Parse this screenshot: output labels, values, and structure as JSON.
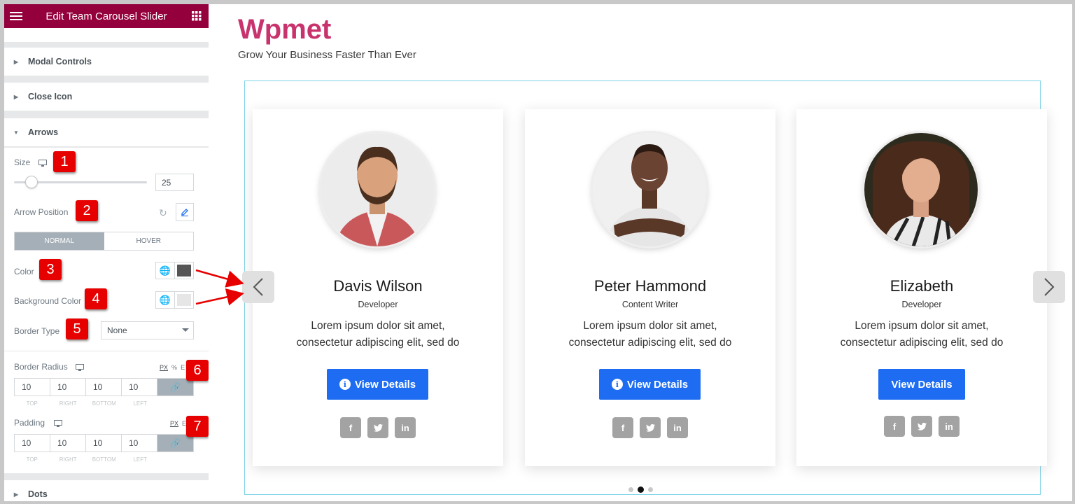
{
  "editor": {
    "title": "Edit Team Carousel Slider",
    "sections": {
      "modal_controls": "Modal Controls",
      "close_icon": "Close Icon",
      "arrows": "Arrows",
      "dots": "Dots"
    },
    "size": {
      "label": "Size",
      "value": "25",
      "slider_fraction": 0.12
    },
    "arrow_position": {
      "label": "Arrow Position"
    },
    "tabs": {
      "normal": "NORMAL",
      "hover": "HOVER"
    },
    "color": {
      "label": "Color",
      "swatch": "#555555"
    },
    "background_color": {
      "label": "Background Color",
      "swatch": "#e6e6e6"
    },
    "border_type": {
      "label": "Border Type",
      "value": "None"
    },
    "border_radius": {
      "label": "Border Radius",
      "units": {
        "px": "PX",
        "percent": "%",
        "em": "E"
      },
      "values": {
        "top": "10",
        "right": "10",
        "bottom": "10",
        "left": "10"
      },
      "labels": {
        "top": "TOP",
        "right": "RIGHT",
        "bottom": "BOTTOM",
        "left": "LEFT"
      }
    },
    "padding": {
      "label": "Padding",
      "units": {
        "px": "PX",
        "em": "E"
      },
      "values": {
        "top": "10",
        "right": "10",
        "bottom": "10",
        "left": "10"
      },
      "labels": {
        "top": "TOP",
        "right": "RIGHT",
        "bottom": "BOTTOM",
        "left": "LEFT"
      }
    },
    "badges": [
      "1",
      "2",
      "3",
      "4",
      "5",
      "6",
      "7"
    ]
  },
  "page": {
    "brand": "Wpmet",
    "tagline": "Grow Your Business Faster Than Ever",
    "members": [
      {
        "name": "Davis Wilson",
        "role": "Developer",
        "desc_line1": "Lorem ipsum dolor sit amet,",
        "desc_line2": "consectetur adipiscing elit, sed do",
        "button": "View Details"
      },
      {
        "name": "Peter Hammond",
        "role": "Content Writer",
        "desc_line1": "Lorem ipsum dolor sit amet,",
        "desc_line2": "consectetur adipiscing elit, sed do",
        "button": "View Details"
      },
      {
        "name": "Elizabeth",
        "role": "Developer",
        "desc_line1": "Lorem ipsum dolor sit amet,",
        "desc_line2": "consectetur adipiscing elit, sed do",
        "button": "View Details"
      }
    ],
    "social": {
      "facebook": "f",
      "twitter": "t",
      "linkedin": "in"
    },
    "active_dot": 2
  },
  "colors": {
    "topbar": "#93003c",
    "brand": "#c8336e",
    "button": "#1d6cf2",
    "badge": "#e60000"
  }
}
